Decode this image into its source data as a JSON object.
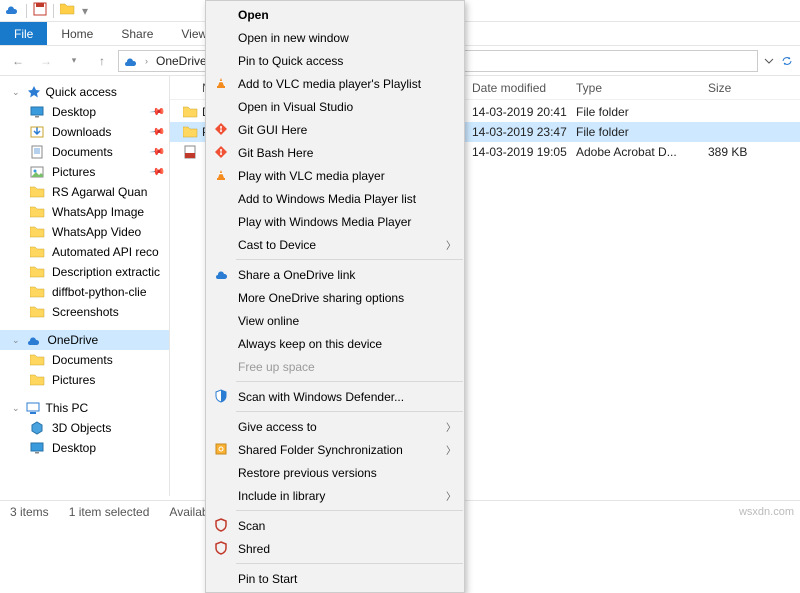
{
  "titlebar": {
    "qat": [
      "onedrive",
      "save",
      "folder",
      "dropdown"
    ]
  },
  "ribbon": {
    "file": "File",
    "home": "Home",
    "share": "Share",
    "view": "View"
  },
  "address": {
    "root": "OneDrive"
  },
  "sidebar": {
    "quick": "Quick access",
    "items": [
      "Desktop",
      "Downloads",
      "Documents",
      "Pictures",
      "RS Agarwal Quan",
      "WhatsApp Image",
      "WhatsApp Video",
      "Automated API reco",
      "Description extractic",
      "diffbot-python-clie",
      "Screenshots"
    ],
    "onedrive": "OneDrive",
    "od_items": [
      "Documents",
      "Pictures"
    ],
    "thispc": "This PC",
    "pc_items": [
      "3D Objects",
      "Desktop"
    ]
  },
  "columns": {
    "name": "Name",
    "date": "Date modified",
    "type": "Type",
    "size": "Size"
  },
  "rows": [
    {
      "icon": "folder",
      "name": "D",
      "date": "14-03-2019 20:41",
      "type": "File folder",
      "size": ""
    },
    {
      "icon": "folder",
      "name": "P",
      "date": "14-03-2019 23:47",
      "type": "File folder",
      "size": "",
      "sel": true
    },
    {
      "icon": "pdf",
      "name": "",
      "date": "14-03-2019 19:05",
      "type": "Adobe Acrobat D...",
      "size": "389 KB"
    }
  ],
  "status": {
    "items": "3 items",
    "sel": "1 item selected",
    "avail": "Available"
  },
  "watermark": "wsxdn.com",
  "ctx": [
    {
      "t": "Open",
      "bold": true
    },
    {
      "t": "Open in new window"
    },
    {
      "t": "Pin to Quick access"
    },
    {
      "t": "Add to VLC media player's Playlist",
      "i": "vlc"
    },
    {
      "t": "Open in Visual Studio"
    },
    {
      "t": "Git GUI Here",
      "i": "git"
    },
    {
      "t": "Git Bash Here",
      "i": "git"
    },
    {
      "t": "Play with VLC media player",
      "i": "vlc"
    },
    {
      "t": "Add to Windows Media Player list"
    },
    {
      "t": "Play with Windows Media Player"
    },
    {
      "t": "Cast to Device",
      "sub": true
    },
    {
      "hr": true
    },
    {
      "t": "Share a OneDrive link",
      "i": "cloud"
    },
    {
      "t": "More OneDrive sharing options"
    },
    {
      "t": "View online"
    },
    {
      "t": "Always keep on this device"
    },
    {
      "t": "Free up space",
      "dis": true
    },
    {
      "hr": true
    },
    {
      "t": "Scan with Windows Defender...",
      "i": "shield"
    },
    {
      "hr": true
    },
    {
      "t": "Give access to",
      "sub": true
    },
    {
      "t": "Shared Folder Synchronization",
      "i": "sync",
      "sub": true
    },
    {
      "t": "Restore previous versions"
    },
    {
      "t": "Include in library",
      "sub": true
    },
    {
      "hr": true
    },
    {
      "t": "Scan",
      "i": "mc"
    },
    {
      "t": "Shred",
      "i": "mc"
    },
    {
      "hr": true
    },
    {
      "t": "Pin to Start"
    }
  ]
}
